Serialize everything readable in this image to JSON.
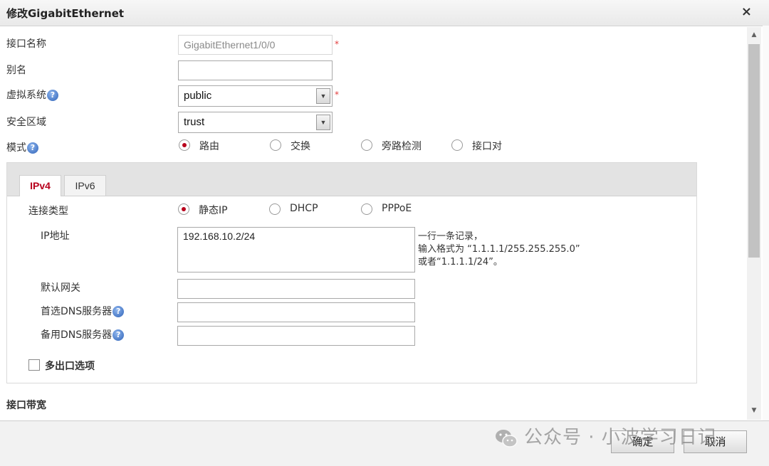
{
  "dialog": {
    "title": "修改GigabitEthernet",
    "close": "×"
  },
  "fields": {
    "interface_name": {
      "label": "接口名称",
      "value": "GigabitEthernet1/0/0"
    },
    "alias": {
      "label": "别名",
      "value": ""
    },
    "vsys": {
      "label": "虚拟系统",
      "value": "public"
    },
    "zone": {
      "label": "安全区域",
      "value": "trust"
    },
    "mode": {
      "label": "模式",
      "options": [
        "路由",
        "交换",
        "旁路检测",
        "接口对"
      ],
      "selected": "路由"
    }
  },
  "help_glyph": "?",
  "required_mark": "*",
  "tabs": [
    {
      "label": "IPv4",
      "active": true
    },
    {
      "label": "IPv6",
      "active": false
    }
  ],
  "ipv4": {
    "conn_type": {
      "label": "连接类型",
      "options": [
        "静态IP",
        "DHCP",
        "PPPoE"
      ],
      "selected": "静态IP"
    },
    "ip_address": {
      "label": "IP地址",
      "value": "192.168.10.2/24",
      "hint": [
        "一行一条记录，",
        "输入格式为 “1.1.1.1/255.255.255.0”",
        "或者“1.1.1.1/24”。"
      ]
    },
    "gateway": {
      "label": "默认网关",
      "value": ""
    },
    "dns_primary": {
      "label": "首选DNS服务器",
      "value": ""
    },
    "dns_secondary": {
      "label": "备用DNS服务器",
      "value": ""
    },
    "multi_egress": {
      "label": "多出口选项",
      "checked": false
    }
  },
  "bandwidth": {
    "label": "接口带宽"
  },
  "footer": {
    "ok": "确定",
    "cancel": "取消"
  },
  "watermark": {
    "text": "公众号 · 小波学习日记"
  },
  "colors": {
    "accent": "#b8001c",
    "required": "#e23d3d"
  }
}
